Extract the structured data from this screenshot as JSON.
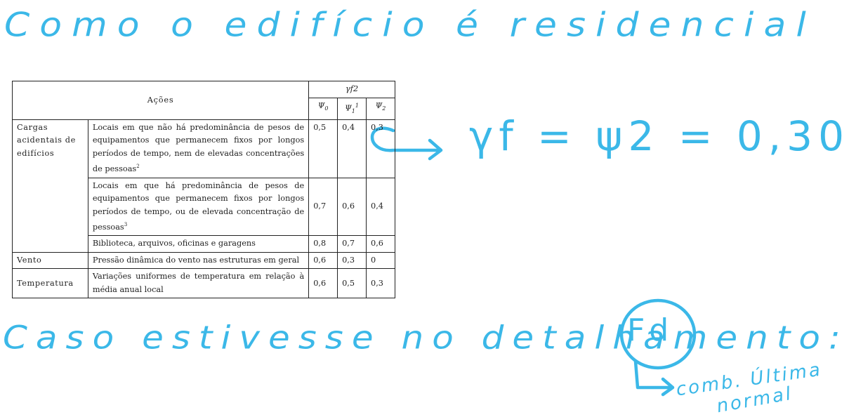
{
  "annotations": {
    "top": "Como o edifício é residencial",
    "formula": "γf = ψ2 = 0,30",
    "bottom": "Caso estivesse no detalhamento:",
    "fd": "Fd",
    "comb": "comb. Última",
    "normal": "normal"
  },
  "table": {
    "header": {
      "acoes": "Ações",
      "gamma": "γf2",
      "psi0": "Ψ",
      "psi0_sub": "0",
      "psi1": "Ψ",
      "psi1_sub": "1",
      "psi1_sup": "1",
      "psi2": "Ψ",
      "psi2_sub": "2"
    },
    "groups": [
      {
        "category": "Cargas acidentais de edifícios",
        "rows": [
          {
            "desc": "Locais em que não há predominância de pesos de equipamentos que permanecem fixos por longos períodos de tempo, nem de elevadas concentrações de pessoas",
            "sup": "2",
            "psi0": "0,5",
            "psi1": "0,4",
            "psi2": "0,3"
          },
          {
            "desc": "Locais em que há predominância de pesos de equipamentos que permanecem fixos por longos períodos de tempo, ou de elevada concentração de pessoas",
            "sup": "3",
            "psi0": "0,7",
            "psi1": "0,6",
            "psi2": "0,4"
          },
          {
            "desc": "Biblioteca, arquivos, oficinas e garagens",
            "sup": "",
            "psi0": "0,8",
            "psi1": "0,7",
            "psi2": "0,6"
          }
        ]
      },
      {
        "category": "Vento",
        "rows": [
          {
            "desc": "Pressão dinâmica do vento nas estruturas em geral",
            "sup": "",
            "psi0": "0,6",
            "psi1": "0,3",
            "psi2": "0"
          }
        ]
      },
      {
        "category": "Temperatura",
        "rows": [
          {
            "desc": "Variações uniformes de temperatura em relação à média anual local",
            "sup": "",
            "psi0": "0,6",
            "psi1": "0,5",
            "psi2": "0,3"
          }
        ]
      }
    ]
  },
  "colors": {
    "ink": "#3bb8e8",
    "table_text": "#222222"
  }
}
